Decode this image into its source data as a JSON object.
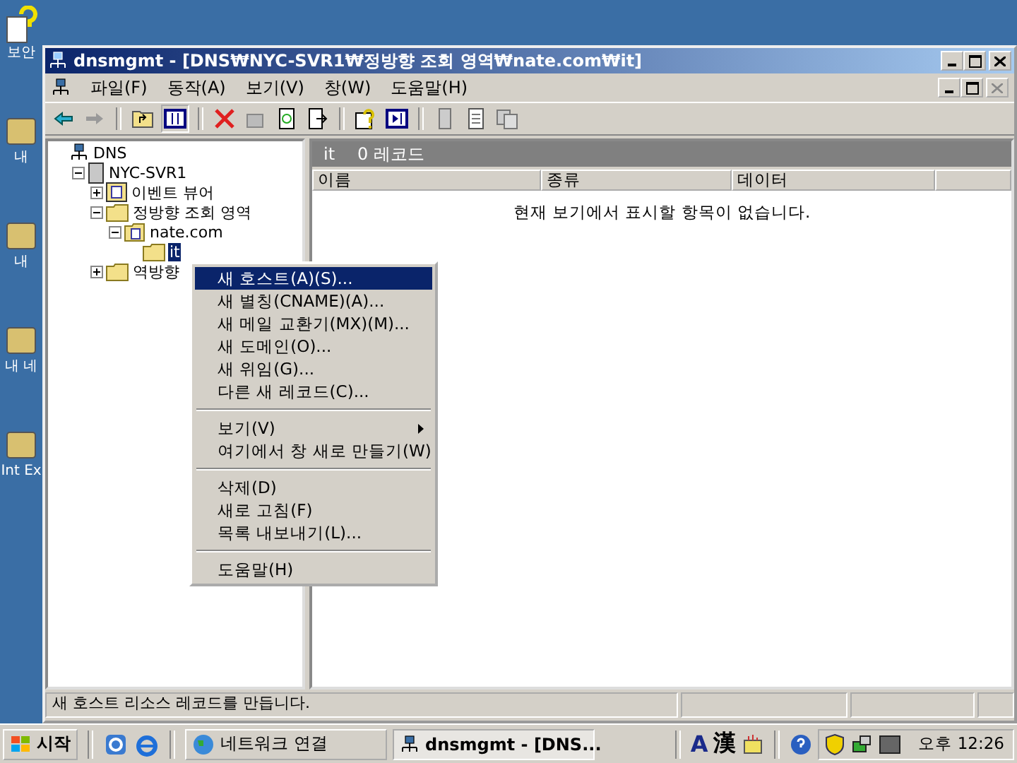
{
  "desktop_icons": [
    {
      "label": "보안"
    },
    {
      "label": "내"
    },
    {
      "label": "내"
    },
    {
      "label": "내 네"
    },
    {
      "label": "Int Ex"
    }
  ],
  "window": {
    "title": "dnsmgmt - [DNS₩NYC-SVR1₩정방향 조회 영역₩nate.com₩it]"
  },
  "menu": [
    "파일(F)",
    "동작(A)",
    "보기(V)",
    "창(W)",
    "도움말(H)"
  ],
  "tree": [
    {
      "label": "DNS",
      "kind": "dns",
      "selected": false,
      "children": [
        {
          "label": "NYC-SVR1",
          "kind": "server",
          "selected": false,
          "expanded": true,
          "children": [
            {
              "label": "이벤트 뷰어",
              "kind": "log",
              "selected": false,
              "expanded": false
            },
            {
              "label": "정방향 조회 영역",
              "kind": "folder",
              "selected": false,
              "expanded": true,
              "children": [
                {
                  "label": "nate.com",
                  "kind": "zone",
                  "selected": false,
                  "expanded": true,
                  "children": [
                    {
                      "label": "it",
                      "kind": "folder",
                      "selected": true
                    }
                  ]
                }
              ]
            },
            {
              "label": "역방향",
              "kind": "folder",
              "selected": false,
              "expanded": false
            }
          ]
        }
      ]
    }
  ],
  "details": {
    "name": "it",
    "count": "0 레코드",
    "columns": [
      "이름",
      "종류",
      "데이터"
    ],
    "empty_message": "현재 보기에서 표시할 항목이 없습니다."
  },
  "context_menu": [
    [
      {
        "label": "새 호스트(A)(S)...",
        "selected": true,
        "submenu": false
      },
      {
        "label": "새 별칭(CNAME)(A)...",
        "selected": false,
        "submenu": false
      },
      {
        "label": "새 메일 교환기(MX)(M)...",
        "selected": false,
        "submenu": false
      },
      {
        "label": "새 도메인(O)...",
        "selected": false,
        "submenu": false
      },
      {
        "label": "새 위임(G)...",
        "selected": false,
        "submenu": false
      },
      {
        "label": "다른 새 레코드(C)...",
        "selected": false,
        "submenu": false
      }
    ],
    [
      {
        "label": "보기(V)",
        "selected": false,
        "submenu": true
      },
      {
        "label": "여기에서 창 새로 만들기(W)",
        "selected": false,
        "submenu": false
      }
    ],
    [
      {
        "label": "삭제(D)",
        "selected": false,
        "submenu": false
      },
      {
        "label": "새로 고침(F)",
        "selected": false,
        "submenu": false
      },
      {
        "label": "목록 내보내기(L)...",
        "selected": false,
        "submenu": false
      }
    ],
    [
      {
        "label": "도움말(H)",
        "selected": false,
        "submenu": false
      }
    ]
  ],
  "status_bar": {
    "text": "새 호스트 리소스 레코드를 만듭니다."
  },
  "taskbar": {
    "start": "시작",
    "tasks": [
      {
        "label": "네트워크 연결",
        "kind": "network",
        "selected": false
      },
      {
        "label": "dnsmgmt - [DNS...",
        "kind": "dns",
        "selected": true
      }
    ],
    "ime": [
      "A",
      "漢"
    ],
    "clock": "오후 12:26"
  }
}
